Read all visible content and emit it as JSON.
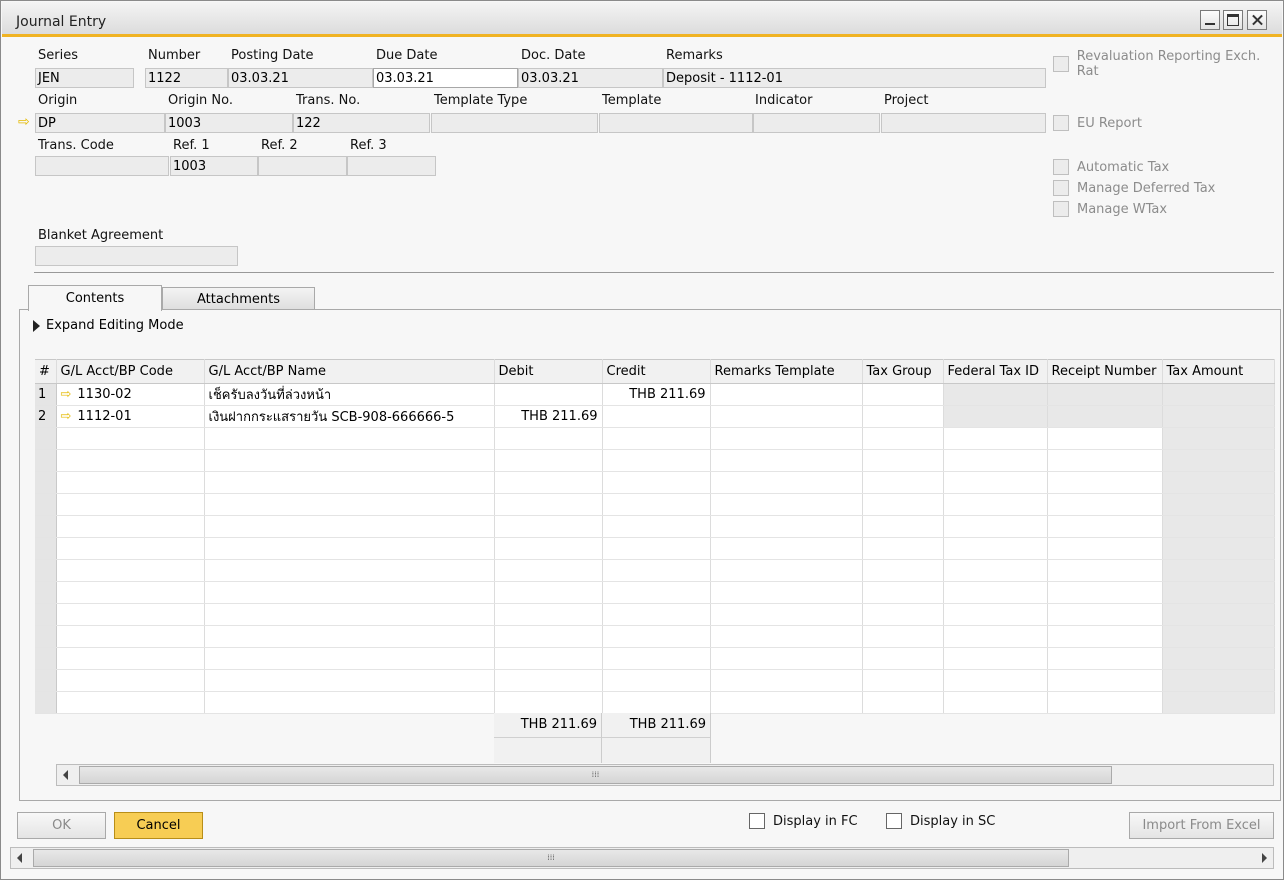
{
  "window": {
    "title": "Journal Entry"
  },
  "header": {
    "series": {
      "label": "Series",
      "value": "JEN"
    },
    "number": {
      "label": "Number",
      "value": "1122"
    },
    "posting_date": {
      "label": "Posting Date",
      "value": "03.03.21"
    },
    "due_date": {
      "label": "Due Date",
      "value": "03.03.21"
    },
    "doc_date": {
      "label": "Doc. Date",
      "value": "03.03.21"
    },
    "remarks": {
      "label": "Remarks",
      "value": "Deposit - 1112-01"
    },
    "origin": {
      "label": "Origin",
      "value": "DP"
    },
    "origin_no": {
      "label": "Origin No.",
      "value": "1003"
    },
    "trans_no": {
      "label": "Trans. No.",
      "value": "122"
    },
    "template_type": {
      "label": "Template Type",
      "value": ""
    },
    "template": {
      "label": "Template",
      "value": ""
    },
    "indicator": {
      "label": "Indicator",
      "value": ""
    },
    "project": {
      "label": "Project",
      "value": ""
    },
    "trans_code": {
      "label": "Trans. Code",
      "value": ""
    },
    "ref1": {
      "label": "Ref. 1",
      "value": "1003"
    },
    "ref2": {
      "label": "Ref. 2",
      "value": ""
    },
    "ref3": {
      "label": "Ref. 3",
      "value": ""
    },
    "blanket_agreement": {
      "label": "Blanket Agreement",
      "value": ""
    }
  },
  "options": {
    "revaluation": "Revaluation Reporting Exch. Rat",
    "eu_report": "EU Report",
    "automatic_tax": "Automatic Tax",
    "manage_deferred_tax": "Manage Deferred Tax",
    "manage_wtax": "Manage WTax"
  },
  "tabs": [
    {
      "label": "Contents"
    },
    {
      "label": "Attachments"
    }
  ],
  "expand_editing_mode": "Expand Editing Mode",
  "grid": {
    "columns": [
      "#",
      "G/L Acct/BP Code",
      "G/L Acct/BP Name",
      "Debit",
      "Credit",
      "Remarks Template",
      "Tax Group",
      "Federal Tax ID",
      "Receipt Number",
      "Tax Amount"
    ],
    "rows": [
      {
        "num": "1",
        "code": "1130-02",
        "name": "เช็ครับลงวันที่ล่วงหน้า",
        "debit": "",
        "credit": "THB 211.69"
      },
      {
        "num": "2",
        "code": "1112-01",
        "name": "เงินฝากกระแสรายวัน SCB-908-666666-5",
        "debit": "THB 211.69",
        "credit": ""
      }
    ],
    "totals": {
      "debit": "THB 211.69",
      "credit": "THB 211.69"
    }
  },
  "footer": {
    "ok": "OK",
    "cancel": "Cancel",
    "display_fc": "Display in FC",
    "display_sc": "Display in SC",
    "import_excel": "Import From Excel"
  },
  "colors": {
    "accent": "#f0b323",
    "cancel_button": "#f7cd54",
    "row_arrow": "#e4b900"
  }
}
